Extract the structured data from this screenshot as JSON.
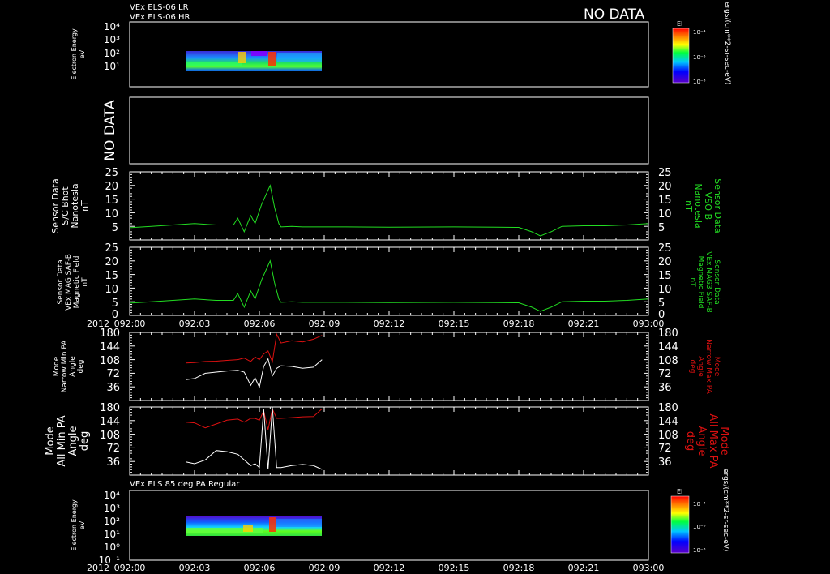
{
  "header": {
    "line1": "VEx ELS-06 LR",
    "line2": "VEx ELS-06 HR",
    "no_data": "NO DATA"
  },
  "colors": {
    "background": "#000000",
    "axis": "#ffffff",
    "green_series": "#22dd22",
    "red_series": "#dd1111",
    "white_series": "#ffffff"
  },
  "time_axis": {
    "year": "2012",
    "ticks": [
      "092:00",
      "092:03",
      "092:06",
      "092:09",
      "092:12",
      "092:15",
      "092:18",
      "092:21",
      "093:00"
    ]
  },
  "panels": {
    "spec1": {
      "ylabel": [
        "Electron Energy",
        "eV"
      ],
      "yticks": [
        "10⁴",
        "10³",
        "10²",
        "10¹"
      ],
      "colorbar_title": "El",
      "colorbar_ticks": [
        "10⁻⁴",
        "10⁻⁶",
        "10⁻⁸"
      ],
      "units": "ergs/(cm**2-sr-sec-eV)"
    },
    "empty": {
      "label": "NO DATA"
    },
    "mag1": {
      "left_label": [
        "Sensor Data",
        "S/C Bhot",
        "Nanotesla",
        "nT"
      ],
      "right_label": [
        "Sensor Data",
        "VSO B",
        "Nanotesla",
        "nT"
      ],
      "yticks": [
        "25",
        "20",
        "15",
        "10",
        "5"
      ]
    },
    "mag2": {
      "left_label": [
        "Sensor Data",
        "VEx MAG SAF-B",
        "Magnetic Field",
        "nT"
      ],
      "right_label": [
        "Sensor Data",
        "VEx MAG3 SAF-B",
        "Magnetic Field",
        "nT"
      ],
      "yticks": [
        "25",
        "20",
        "15",
        "10",
        "5",
        "0"
      ]
    },
    "pa1": {
      "left_label": [
        "Mode",
        "Narrow Min PA",
        "Angle",
        "deg"
      ],
      "right_label": [
        "Mode",
        "Narrow Max PA",
        "Angle",
        "deg"
      ],
      "yticks": [
        "180",
        "144",
        "108",
        "72",
        "36"
      ]
    },
    "pa2": {
      "left_label": [
        "Mode",
        "All Min PA",
        "Angle",
        "deg"
      ],
      "right_label": [
        "Mode",
        "All Max PA",
        "Angle",
        "deg"
      ],
      "yticks": [
        "180",
        "144",
        "108",
        "72",
        "36"
      ]
    },
    "spec2": {
      "title": "VEx ELS 85 deg PA Regular",
      "ylabel": [
        "Electron Energy",
        "eV"
      ],
      "yticks": [
        "10⁴",
        "10³",
        "10²",
        "10¹",
        "10⁰"
      ],
      "bottom_tick": "10⁻¹",
      "colorbar_title": "El",
      "colorbar_ticks": [
        "10⁻⁴",
        "10⁻⁶",
        "10⁻⁸"
      ],
      "units": "ergs/(cm**2-sr-sec-eV)"
    }
  },
  "chart_data": [
    {
      "type": "heatmap",
      "title": "VEx ELS-06 LR / VEx ELS-06 HR",
      "xlabel": "2012",
      "ylabel": "Electron Energy eV",
      "x_range": [
        "092:00",
        "093:00"
      ],
      "data_extent_time": [
        "092:02:40",
        "092:08:55"
      ],
      "energy_range_ev": [
        10,
        200
      ],
      "colorscale": "rainbow log, 10^-8 to 10^-4 ergs/(cm**2-sr-sec-eV)"
    },
    {
      "type": "line",
      "title": "Sensor Data S/C Bhot / VSO B",
      "ylabel": "nT",
      "ylim": [
        0,
        25
      ],
      "x_minutes_from_092_00": [
        0,
        1,
        2,
        3,
        4,
        4.8,
        5,
        5.3,
        5.6,
        5.8,
        6.1,
        6.5,
        6.7,
        6.9,
        7,
        7.5,
        8,
        9,
        10,
        12,
        15,
        17,
        18,
        18.6,
        19,
        19.5,
        20,
        21,
        22,
        23,
        24
      ],
      "series": [
        {
          "values": [
            4.5,
            5,
            5.5,
            6,
            5.5,
            5.5,
            8,
            3,
            9,
            6,
            13,
            20,
            12,
            6,
            4.8,
            5,
            4.8,
            4.8,
            4.8,
            4.7,
            4.8,
            4.7,
            4.6,
            3,
            1.5,
            3,
            5,
            5.2,
            5.2,
            5.5,
            6
          ]
        }
      ]
    },
    {
      "type": "line",
      "title": "Sensor Data VEx MAG SAF-B / VEx MAG3 SAF-B",
      "ylabel": "nT",
      "ylim": [
        0,
        25
      ],
      "x_minutes_from_092_00": [
        0,
        1,
        2,
        3,
        4,
        4.8,
        5,
        5.3,
        5.6,
        5.8,
        6.1,
        6.5,
        6.7,
        6.9,
        7,
        7.5,
        8,
        9,
        10,
        12,
        15,
        17,
        18,
        18.6,
        19,
        19.5,
        20,
        21,
        22,
        23,
        24
      ],
      "series": [
        {
          "values": [
            4.5,
            5,
            5.5,
            6,
            5.5,
            5.5,
            8,
            3,
            9,
            6,
            13,
            20,
            12,
            6,
            4.8,
            5,
            4.8,
            4.8,
            4.8,
            4.7,
            4.8,
            4.7,
            4.6,
            3,
            1.5,
            3,
            5,
            5.2,
            5.2,
            5.5,
            6
          ]
        }
      ]
    },
    {
      "type": "line",
      "title": "Mode Narrow Min PA / Narrow Max PA",
      "ylabel": "deg",
      "ylim": [
        0,
        180
      ],
      "x_minutes_from_092_00": [
        2.6,
        3,
        3.5,
        4,
        4.5,
        5,
        5.3,
        5.6,
        5.8,
        6,
        6.2,
        6.4,
        6.6,
        6.8,
        7,
        7.5,
        8,
        8.5,
        8.9
      ],
      "series": [
        {
          "values": [
            99,
            100,
            103,
            104,
            106,
            108,
            112,
            103,
            115,
            108,
            123,
            131,
            102,
            175,
            152,
            158,
            155,
            162,
            172
          ]
        },
        {
          "values": [
            55,
            58,
            72,
            75,
            78,
            80,
            75,
            40,
            60,
            35,
            90,
            110,
            65,
            85,
            92,
            90,
            85,
            88,
            108
          ]
        }
      ]
    },
    {
      "type": "line",
      "title": "Mode All Min PA / All Max PA",
      "ylabel": "deg",
      "ylim": [
        0,
        180
      ],
      "x_minutes_from_092_00": [
        2.6,
        3,
        3.5,
        4,
        4.5,
        5,
        5.3,
        5.6,
        5.8,
        6,
        6.2,
        6.4,
        6.6,
        6.8,
        7,
        7.5,
        8,
        8.5,
        8.9
      ],
      "series": [
        {
          "values": [
            140,
            138,
            125,
            135,
            145,
            148,
            140,
            150,
            150,
            145,
            170,
            120,
            175,
            150,
            150,
            152,
            154,
            155,
            175
          ]
        },
        {
          "values": [
            35,
            30,
            40,
            65,
            62,
            55,
            40,
            25,
            30,
            20,
            175,
            15,
            180,
            20,
            20,
            25,
            28,
            25,
            15
          ]
        }
      ]
    },
    {
      "type": "heatmap",
      "title": "VEx ELS 85 deg PA Regular",
      "xlabel": "2012",
      "ylabel": "Electron Energy eV",
      "x_range": [
        "092:00",
        "093:00"
      ],
      "data_extent_time": [
        "092:02:40",
        "092:08:55"
      ],
      "energy_range_ev": [
        3,
        200
      ],
      "colorscale": "rainbow log, 10^-8 to 10^-4 ergs/(cm**2-sr-sec-eV)"
    }
  ]
}
